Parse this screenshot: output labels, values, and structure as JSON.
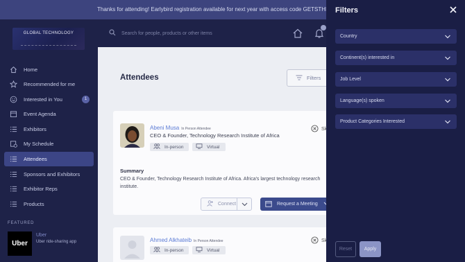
{
  "banner": {
    "text": "Thanks for attending! Earlybird registration available for next year with access code GETSTHEWORD"
  },
  "logo": {
    "text": "GLOBAL TECHNOLOGY"
  },
  "search": {
    "placeholder": "Search for people, products or other items"
  },
  "sidebar": {
    "items": [
      {
        "label": "Home",
        "icon": "home-icon"
      },
      {
        "label": "Recommended for me",
        "icon": "star-icon"
      },
      {
        "label": "Interested in You",
        "icon": "smile-icon",
        "badge": "1"
      },
      {
        "label": "Event Agenda",
        "icon": "calendar-icon"
      },
      {
        "label": "Exhibitors",
        "icon": "list-icon"
      },
      {
        "label": "My Schedule",
        "icon": "schedule-icon"
      },
      {
        "label": "Attendees",
        "icon": "list-icon",
        "active": true
      },
      {
        "label": "Sponsors and Exhibitors",
        "icon": "list-icon"
      },
      {
        "label": "Exhibitor Reps",
        "icon": "list-icon"
      },
      {
        "label": "Products",
        "icon": "list-icon"
      }
    ],
    "featured": {
      "label": "FEATURED",
      "logo_text": "Uber",
      "name": "Uber",
      "description": "Uber ride-sharing app"
    }
  },
  "main": {
    "title": "Attendees",
    "filters_label": "Filters",
    "attendees": [
      {
        "name": "Abeni Musa",
        "tag": "In Person Attendee",
        "role": "CEO & Founder, Technology Research Institute of Africa",
        "chips": [
          "In-person",
          "Virtual"
        ],
        "remove_label": "Sk",
        "summary_heading": "Summary",
        "summary": "CEO & Founder, Technology Research Institute of Africa. Africa's largest technology research institute.",
        "connect_label": "Connect",
        "meeting_label": "Request a Meeting"
      },
      {
        "name": "Ahmed Alkhateib",
        "tag": "In Person Attendee",
        "chips": [
          "In-person",
          "Virtual"
        ],
        "remove_label": "Sk"
      }
    ]
  },
  "filter_panel": {
    "title": "Filters",
    "filters": [
      "Country",
      "Continent(s) interested in",
      "Job Level",
      "Language(s) spoken",
      "Product Categories Interested"
    ],
    "reset_label": "Reset",
    "apply_label": "Apply"
  },
  "colors": {
    "sidebar_bg": "#1e2248",
    "panel_bg": "#1a1e45",
    "filter_row_bg": "#2b3068",
    "active_nav": "#3c4586",
    "link": "#5b7bd5",
    "primary_button": "#3b4a8c"
  }
}
